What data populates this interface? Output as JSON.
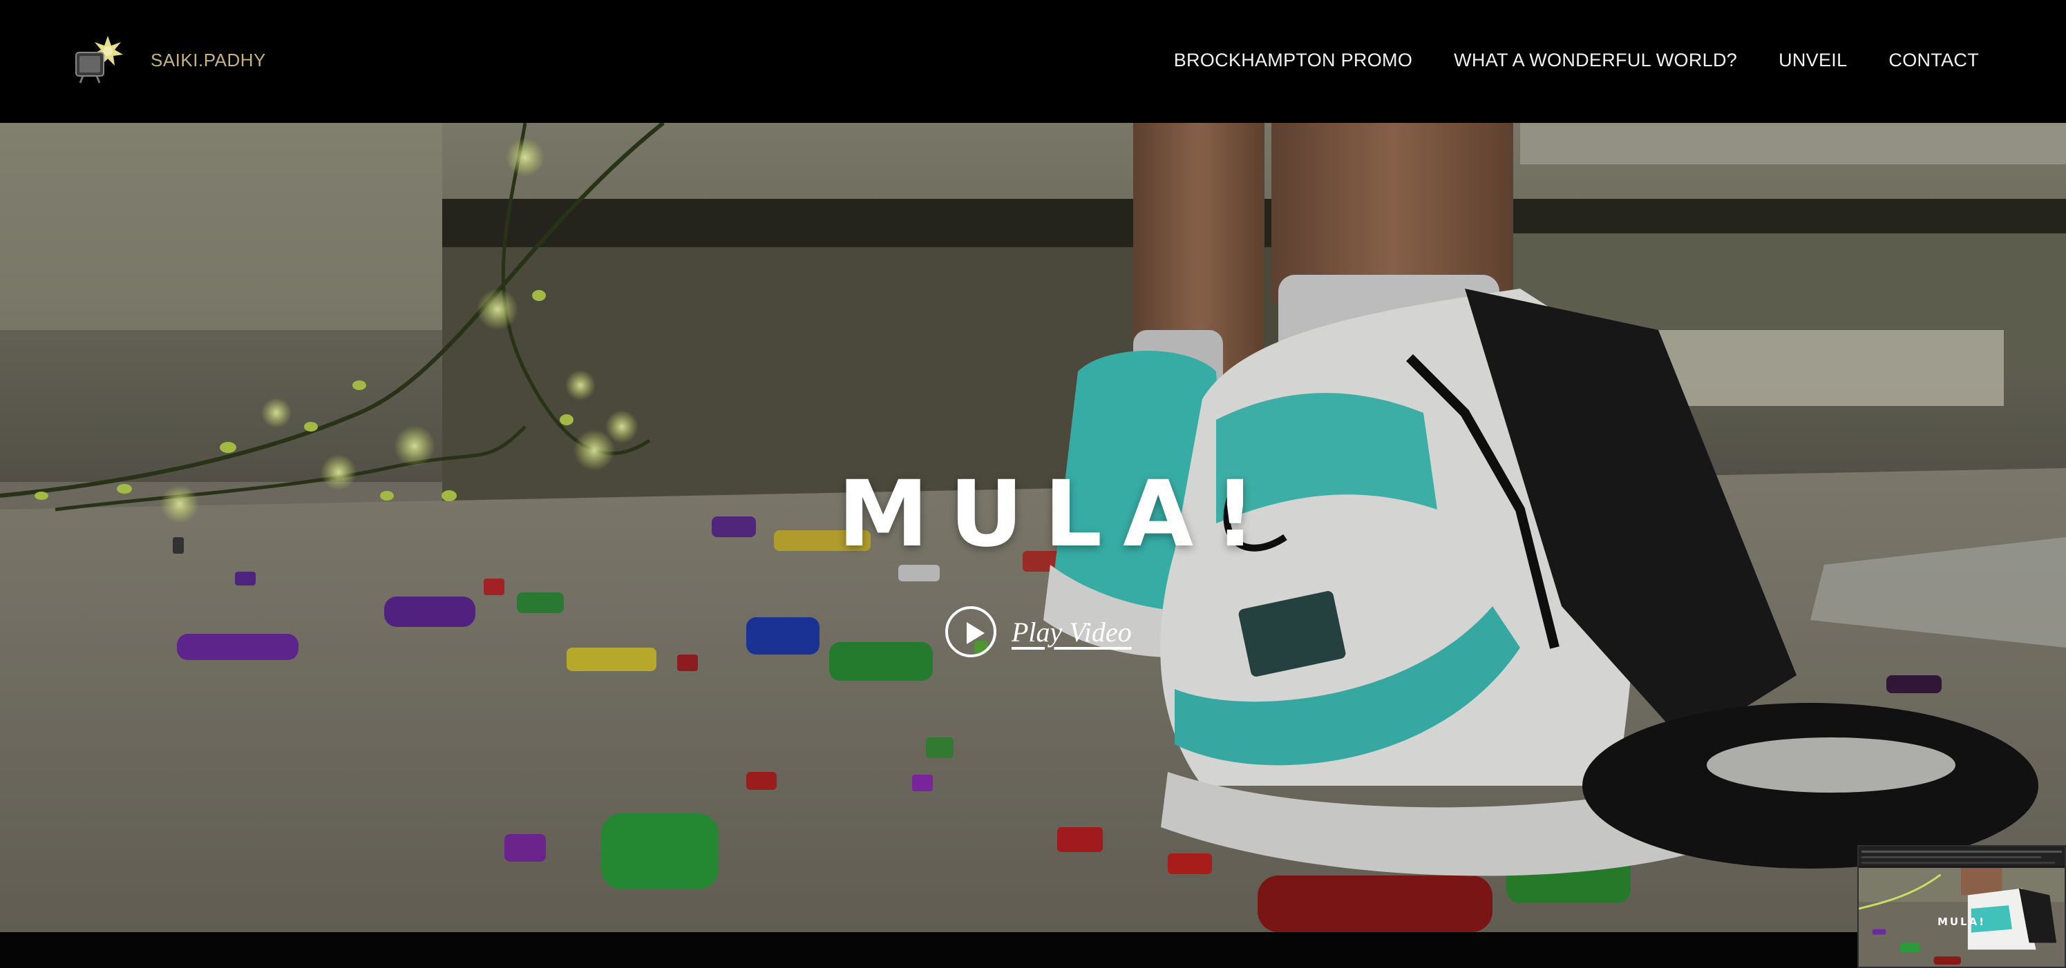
{
  "header": {
    "site_name": "SAIKI.PADHY",
    "logo_icon": "sun-tv-logo",
    "nav": [
      {
        "label": "BROCKHAMPTON PROMO"
      },
      {
        "label": "WHAT A WONDERFUL WORLD?"
      },
      {
        "label": "UNVEIL"
      },
      {
        "label": "CONTACT"
      }
    ]
  },
  "hero": {
    "title": "MULA!",
    "play_label": "Play Video",
    "play_icon": "play-circle-icon"
  },
  "thumbnail": {
    "title": "MULA!"
  },
  "colors": {
    "background": "#000000",
    "brand": "#c6b27e",
    "nav_text": "#f2f2f2",
    "hero_text": "#ffffff"
  }
}
